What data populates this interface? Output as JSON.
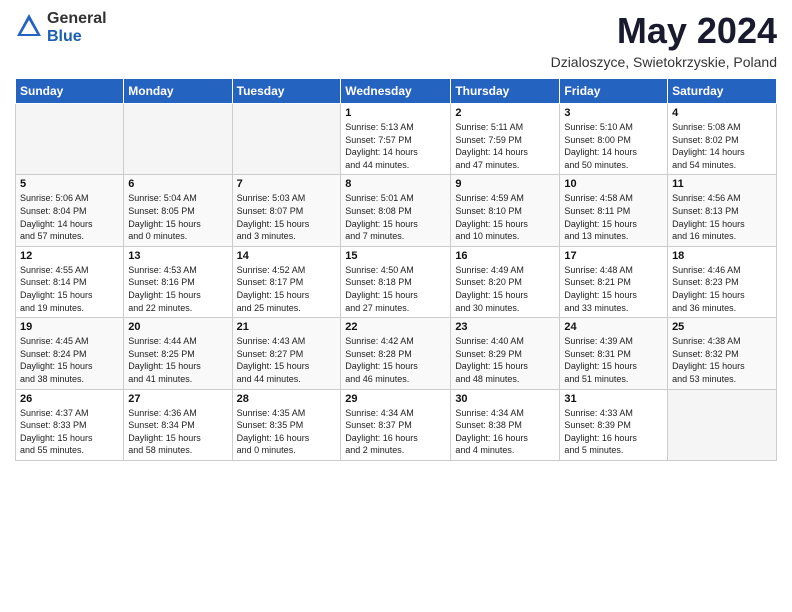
{
  "header": {
    "logo_general": "General",
    "logo_blue": "Blue",
    "month_title": "May 2024",
    "location": "Dzialoszyce, Swietokrzyskie, Poland"
  },
  "weekdays": [
    "Sunday",
    "Monday",
    "Tuesday",
    "Wednesday",
    "Thursday",
    "Friday",
    "Saturday"
  ],
  "weeks": [
    [
      {
        "day": "",
        "info": ""
      },
      {
        "day": "",
        "info": ""
      },
      {
        "day": "",
        "info": ""
      },
      {
        "day": "1",
        "info": "Sunrise: 5:13 AM\nSunset: 7:57 PM\nDaylight: 14 hours\nand 44 minutes."
      },
      {
        "day": "2",
        "info": "Sunrise: 5:11 AM\nSunset: 7:59 PM\nDaylight: 14 hours\nand 47 minutes."
      },
      {
        "day": "3",
        "info": "Sunrise: 5:10 AM\nSunset: 8:00 PM\nDaylight: 14 hours\nand 50 minutes."
      },
      {
        "day": "4",
        "info": "Sunrise: 5:08 AM\nSunset: 8:02 PM\nDaylight: 14 hours\nand 54 minutes."
      }
    ],
    [
      {
        "day": "5",
        "info": "Sunrise: 5:06 AM\nSunset: 8:04 PM\nDaylight: 14 hours\nand 57 minutes."
      },
      {
        "day": "6",
        "info": "Sunrise: 5:04 AM\nSunset: 8:05 PM\nDaylight: 15 hours\nand 0 minutes."
      },
      {
        "day": "7",
        "info": "Sunrise: 5:03 AM\nSunset: 8:07 PM\nDaylight: 15 hours\nand 3 minutes."
      },
      {
        "day": "8",
        "info": "Sunrise: 5:01 AM\nSunset: 8:08 PM\nDaylight: 15 hours\nand 7 minutes."
      },
      {
        "day": "9",
        "info": "Sunrise: 4:59 AM\nSunset: 8:10 PM\nDaylight: 15 hours\nand 10 minutes."
      },
      {
        "day": "10",
        "info": "Sunrise: 4:58 AM\nSunset: 8:11 PM\nDaylight: 15 hours\nand 13 minutes."
      },
      {
        "day": "11",
        "info": "Sunrise: 4:56 AM\nSunset: 8:13 PM\nDaylight: 15 hours\nand 16 minutes."
      }
    ],
    [
      {
        "day": "12",
        "info": "Sunrise: 4:55 AM\nSunset: 8:14 PM\nDaylight: 15 hours\nand 19 minutes."
      },
      {
        "day": "13",
        "info": "Sunrise: 4:53 AM\nSunset: 8:16 PM\nDaylight: 15 hours\nand 22 minutes."
      },
      {
        "day": "14",
        "info": "Sunrise: 4:52 AM\nSunset: 8:17 PM\nDaylight: 15 hours\nand 25 minutes."
      },
      {
        "day": "15",
        "info": "Sunrise: 4:50 AM\nSunset: 8:18 PM\nDaylight: 15 hours\nand 27 minutes."
      },
      {
        "day": "16",
        "info": "Sunrise: 4:49 AM\nSunset: 8:20 PM\nDaylight: 15 hours\nand 30 minutes."
      },
      {
        "day": "17",
        "info": "Sunrise: 4:48 AM\nSunset: 8:21 PM\nDaylight: 15 hours\nand 33 minutes."
      },
      {
        "day": "18",
        "info": "Sunrise: 4:46 AM\nSunset: 8:23 PM\nDaylight: 15 hours\nand 36 minutes."
      }
    ],
    [
      {
        "day": "19",
        "info": "Sunrise: 4:45 AM\nSunset: 8:24 PM\nDaylight: 15 hours\nand 38 minutes."
      },
      {
        "day": "20",
        "info": "Sunrise: 4:44 AM\nSunset: 8:25 PM\nDaylight: 15 hours\nand 41 minutes."
      },
      {
        "day": "21",
        "info": "Sunrise: 4:43 AM\nSunset: 8:27 PM\nDaylight: 15 hours\nand 44 minutes."
      },
      {
        "day": "22",
        "info": "Sunrise: 4:42 AM\nSunset: 8:28 PM\nDaylight: 15 hours\nand 46 minutes."
      },
      {
        "day": "23",
        "info": "Sunrise: 4:40 AM\nSunset: 8:29 PM\nDaylight: 15 hours\nand 48 minutes."
      },
      {
        "day": "24",
        "info": "Sunrise: 4:39 AM\nSunset: 8:31 PM\nDaylight: 15 hours\nand 51 minutes."
      },
      {
        "day": "25",
        "info": "Sunrise: 4:38 AM\nSunset: 8:32 PM\nDaylight: 15 hours\nand 53 minutes."
      }
    ],
    [
      {
        "day": "26",
        "info": "Sunrise: 4:37 AM\nSunset: 8:33 PM\nDaylight: 15 hours\nand 55 minutes."
      },
      {
        "day": "27",
        "info": "Sunrise: 4:36 AM\nSunset: 8:34 PM\nDaylight: 15 hours\nand 58 minutes."
      },
      {
        "day": "28",
        "info": "Sunrise: 4:35 AM\nSunset: 8:35 PM\nDaylight: 16 hours\nand 0 minutes."
      },
      {
        "day": "29",
        "info": "Sunrise: 4:34 AM\nSunset: 8:37 PM\nDaylight: 16 hours\nand 2 minutes."
      },
      {
        "day": "30",
        "info": "Sunrise: 4:34 AM\nSunset: 8:38 PM\nDaylight: 16 hours\nand 4 minutes."
      },
      {
        "day": "31",
        "info": "Sunrise: 4:33 AM\nSunset: 8:39 PM\nDaylight: 16 hours\nand 5 minutes."
      },
      {
        "day": "",
        "info": ""
      }
    ]
  ]
}
